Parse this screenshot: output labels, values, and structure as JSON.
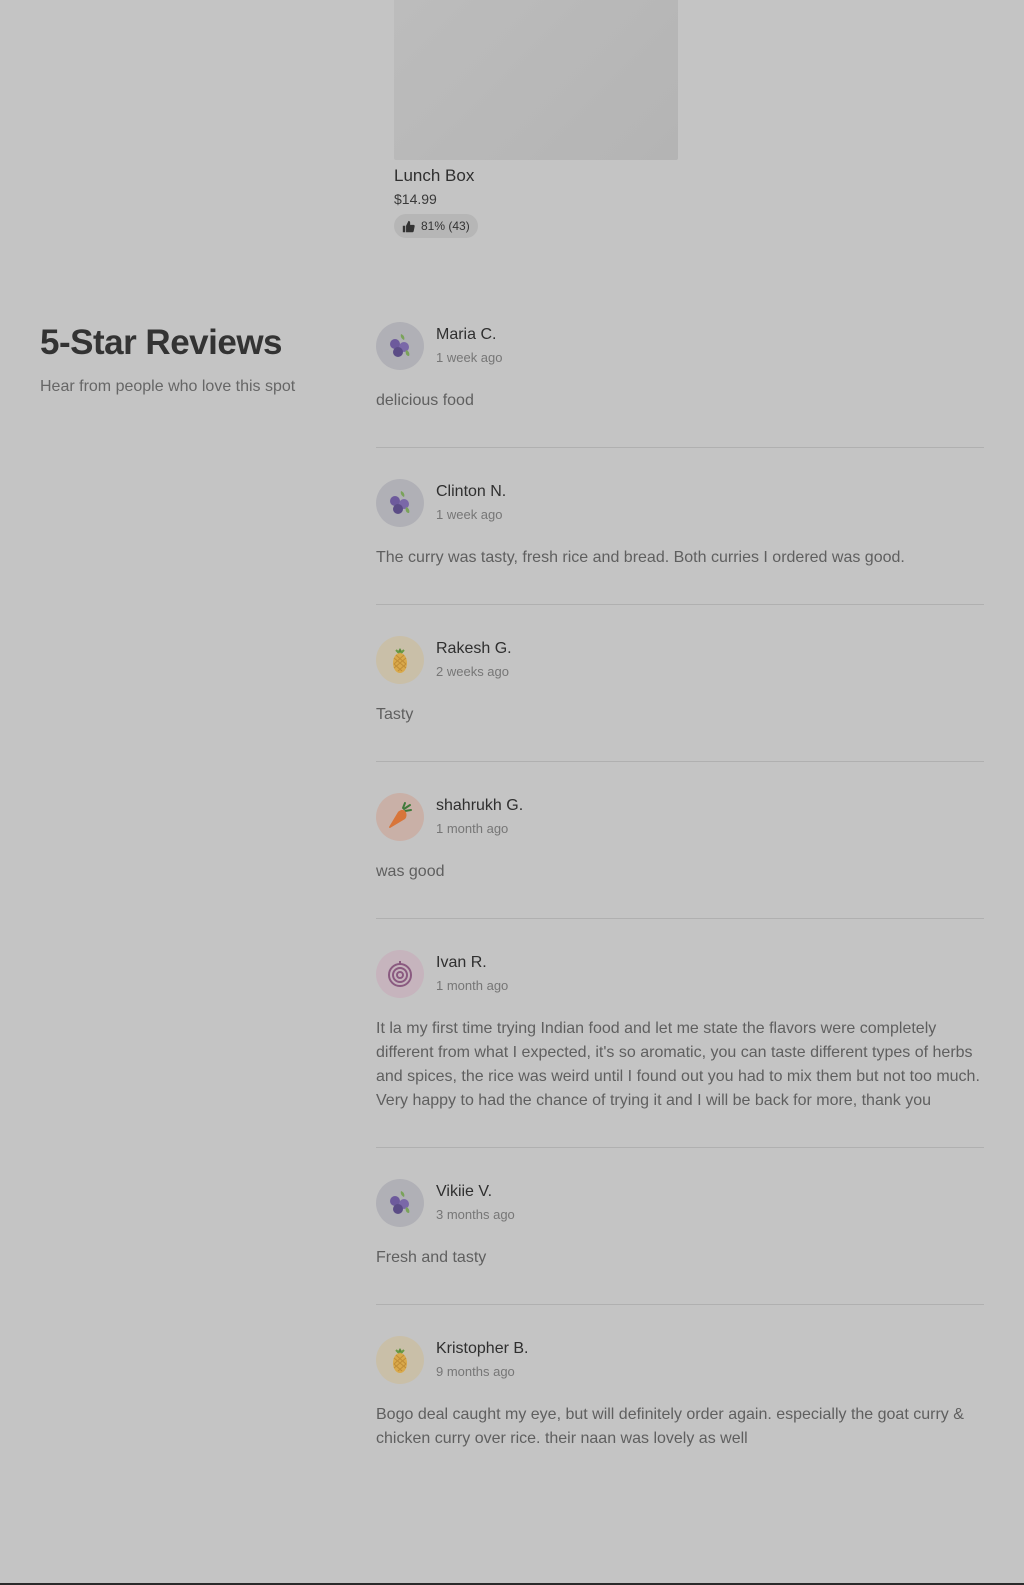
{
  "product": {
    "name": "Lunch Box",
    "price": "$14.99",
    "rating": "81% (43)",
    "rating_icon": "thumbs-up-icon"
  },
  "reviews_section": {
    "title": "5-Star Reviews",
    "subtitle": "Hear from people who love this spot"
  },
  "reviews": [
    {
      "name": "Maria C.",
      "date": "1 week ago",
      "text": "delicious food",
      "avatar": "blueberry-icon"
    },
    {
      "name": "Clinton N.",
      "date": "1 week ago",
      "text": "The curry was tasty, fresh rice and bread. Both curries I ordered was good.",
      "avatar": "blueberry-icon"
    },
    {
      "name": "Rakesh G.",
      "date": "2 weeks ago",
      "text": "Tasty",
      "avatar": "pineapple-icon"
    },
    {
      "name": "shahrukh G.",
      "date": "1 month ago",
      "text": "was good",
      "avatar": "carrot-icon"
    },
    {
      "name": "Ivan R.",
      "date": "1 month ago",
      "text": "It la my first time trying Indian food and let me state the flavors were completely different from what I expected, it's so aromatic, you can taste different types of herbs and spices, the rice was weird until I found out you had to mix them but not too much. Very happy to had the chance of trying it and I will be back for more, thank you",
      "avatar": "onion-icon"
    },
    {
      "name": "Vikiie V.",
      "date": "3 months ago",
      "text": "Fresh and tasty",
      "avatar": "blueberry-icon"
    },
    {
      "name": "Kristopher B.",
      "date": "9 months ago",
      "text": "Bogo deal caught my eye, but will definitely order again. especially the goat curry & chicken curry over rice. their naan was lovely as well",
      "avatar": "pineapple-icon"
    }
  ]
}
